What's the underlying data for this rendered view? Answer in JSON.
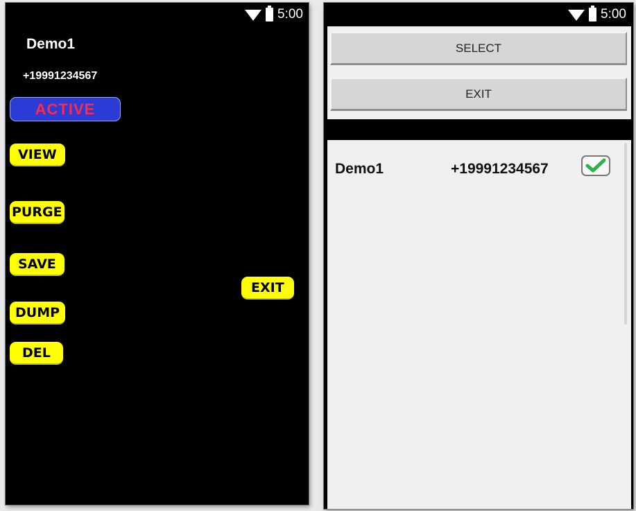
{
  "left_screen": {
    "status_bar": {
      "time": "5:00",
      "icons": [
        "wifi-icon",
        "battery-icon"
      ]
    },
    "contact_name": "Demo1",
    "contact_phone": "+19991234567",
    "status_badge": "ACTIVE",
    "buttons": {
      "view": "VIEW",
      "purge": "PURGE",
      "save": "SAVE",
      "dump": "DUMP",
      "del": "DEL",
      "exit": "EXIT"
    },
    "colors": {
      "background": "#000000",
      "button": "#ffff00",
      "badge_bg": "#2a3bd6",
      "badge_text": "#ff2a4a"
    }
  },
  "right_screen": {
    "status_bar": {
      "time": "5:00",
      "icons": [
        "wifi-icon",
        "battery-icon"
      ]
    },
    "buttons": {
      "select": "SELECT",
      "exit": "EXIT"
    },
    "list": [
      {
        "name": "Demo1",
        "phone": "+19991234567",
        "checked": true
      }
    ],
    "colors": {
      "list_bg": "#f0f0f0",
      "button_bg": "#d6d6d6",
      "check": "#2db34a"
    }
  }
}
